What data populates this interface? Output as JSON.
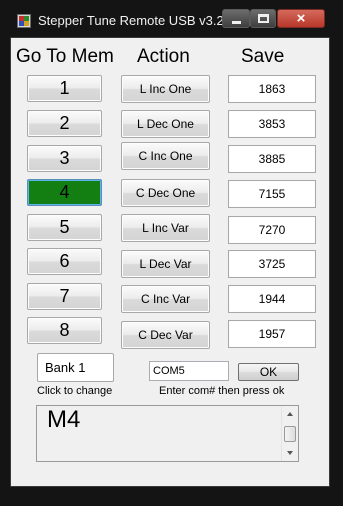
{
  "window": {
    "title": "Stepper Tune Remote USB v3.2",
    "icon": "app-icon",
    "controls": {
      "minimize": "minimize-icon",
      "maximize": "maximize-icon",
      "close": "×"
    }
  },
  "headers": {
    "goto": "Go To Mem",
    "action": "Action",
    "save": "Save"
  },
  "memory_buttons": [
    "1",
    "2",
    "3",
    "4",
    "5",
    "6",
    "7",
    "8"
  ],
  "active_memory": "4",
  "active_color": "#137f13",
  "action_buttons": [
    "L Inc One",
    "L Dec One",
    "C Inc One",
    "C Dec One",
    "L Inc Var",
    "L Dec Var",
    "C Inc Var",
    "C Dec Var"
  ],
  "save_values": [
    "1863",
    "3853",
    "3885",
    "7155",
    "7270",
    "3725",
    "1944",
    "1957"
  ],
  "bank": {
    "label": "Bank 1",
    "hint": "Click to change"
  },
  "com": {
    "value": "COM5",
    "ok_label": "OK",
    "hint": "Enter com# then press ok"
  },
  "log": {
    "text": "M4"
  }
}
